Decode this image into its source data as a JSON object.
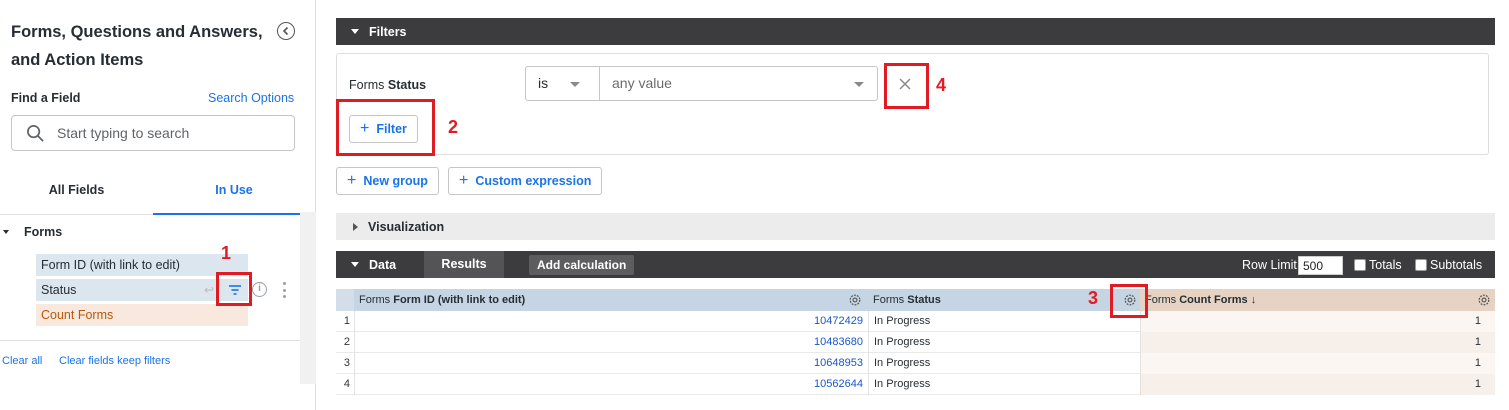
{
  "sidebar": {
    "title": "Forms, Questions and Answers, and Action Items",
    "find_field_label": "Find a Field",
    "search_options": "Search Options",
    "search_placeholder": "Start typing to search",
    "tabs": [
      {
        "label": "All Fields"
      },
      {
        "label": "In Use",
        "active": true
      }
    ],
    "group": "Forms",
    "fields": [
      {
        "label": "Form ID (with link to edit)",
        "kind": "dimension"
      },
      {
        "label": "Status",
        "kind": "dimension"
      },
      {
        "label": "Count Forms",
        "kind": "measure"
      }
    ],
    "clear_all": "Clear all",
    "clear_keep": "Clear fields keep filters"
  },
  "filters": {
    "section_label": "Filters",
    "row": {
      "view": "Forms",
      "field": "Status",
      "operator": "is",
      "value": "any value"
    },
    "add_filter_label": "Filter",
    "new_group_label": "New group",
    "custom_expression_label": "Custom expression"
  },
  "visualization": {
    "label": "Visualization"
  },
  "data": {
    "label": "Data",
    "results_tab": "Results",
    "add_calculation": "Add calculation",
    "row_limit_label": "Row Limit",
    "row_limit_value": "500",
    "totals_label": "Totals",
    "subtotals_label": "Subtotals",
    "columns": [
      {
        "view": "Forms",
        "field": "Form ID (with link to edit)"
      },
      {
        "view": "Forms",
        "field": "Status"
      },
      {
        "view": "Forms",
        "field": "Count Forms ↓"
      }
    ],
    "rows": [
      {
        "idx": "1",
        "form_id": "10472429",
        "status": "In Progress",
        "count": "1"
      },
      {
        "idx": "2",
        "form_id": "10483680",
        "status": "In Progress",
        "count": "1"
      },
      {
        "idx": "3",
        "form_id": "10648953",
        "status": "In Progress",
        "count": "1"
      },
      {
        "idx": "4",
        "form_id": "10562644",
        "status": "In Progress",
        "count": "1"
      }
    ]
  },
  "annotations": [
    "1",
    "2",
    "3",
    "4"
  ],
  "colors": {
    "accent": "#1a73e8",
    "header_bar": "#3c3c3e",
    "annotation": "#e01b24",
    "dimension_bg": "#dce6ef",
    "measure_bg": "#f8e8de"
  }
}
